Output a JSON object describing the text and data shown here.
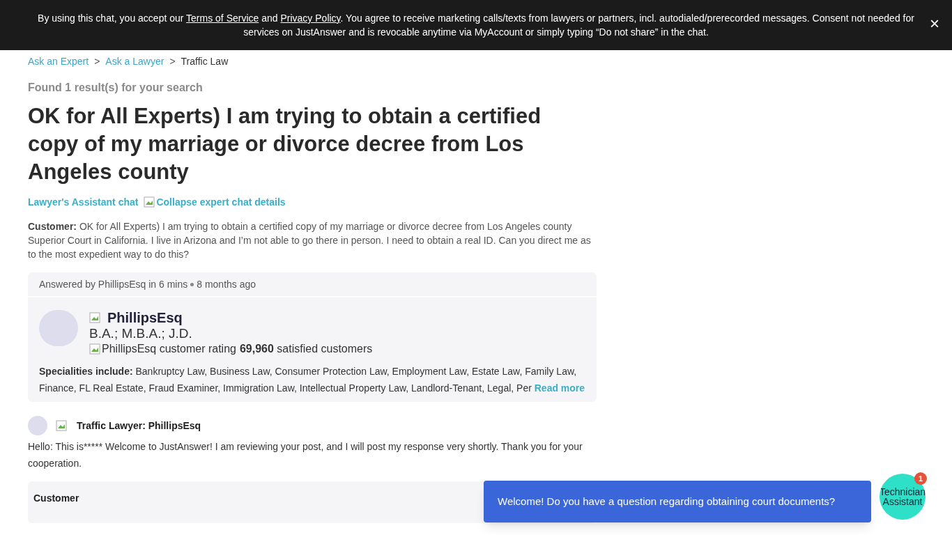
{
  "consent_banner": {
    "text_before": "By using this chat, you accept our ",
    "terms_link": "Terms of Service",
    "text_and": " and ",
    "privacy_link": "Privacy Policy",
    "text_after": ". You agree to receive marketing calls/texts from lawyers or partners, incl. autodialed/prerecorded messages. Consent not needed for services on JustAnswer and is revocable anytime via MyAccount or simply typing “Do not share” in the chat.",
    "close": "×"
  },
  "breadcrumbs": [
    {
      "label": "Ask an Expert"
    },
    {
      "label": "Ask a Lawyer"
    },
    {
      "label": "Traffic Law"
    }
  ],
  "breadcrumb_separator": ">",
  "result_count": "Found 1 result(s) for your search",
  "title": "OK for All Experts) I am trying to obtain a certified copy of my marriage or divorce decree from Los Angeles county",
  "chat_link": "Lawyer's Assistant chat",
  "collapse_link": "Collapse expert chat details",
  "question": {
    "label": "Customer:",
    "text": " OK for All Experts) I am trying to obtain a certified copy of my marriage or divorce decree from Los Angeles county Superior Court in California. I live in Arizona and I’m not able to go there in person. I need to obtain a real ID. Can you direct me as to the most expedient way to do this?"
  },
  "answer_card": {
    "answered_by": "Answered by PhillipsEsq in 6 mins",
    "time": "8 months ago",
    "expert_name": "PhillipsEsq",
    "degrees": "B.A.; M.B.A.; J.D.",
    "rating_alt": "PhillipsEsq customer rating",
    "customers_count": "69,960",
    "customers_label": " satisfied customers",
    "specialities_label": "Specialities include:",
    "specialities": " Bankruptcy Law, Business Law, Consumer Protection Law, Employment Law, Estate Law, Family Law, Finance, FL Real Estate, Fraud Examiner, Immigration Law, Intellectual Property Law, Landlord-Tenant, Legal, Per",
    "read_more": "Read more"
  },
  "messages": [
    {
      "author": "Traffic Lawyer: PhillipsEsq",
      "text": "Hello: This is***** Welcome to JustAnswer! I am reviewing your post, and I will post my response very shortly. Thank you for your cooperation."
    }
  ],
  "next_message_header": "Customer",
  "chat_widget": {
    "bubble": "Welcome! Do you have a question regarding obtaining court documents?",
    "avatar_text": "Technician Assistant",
    "badge": "1"
  }
}
